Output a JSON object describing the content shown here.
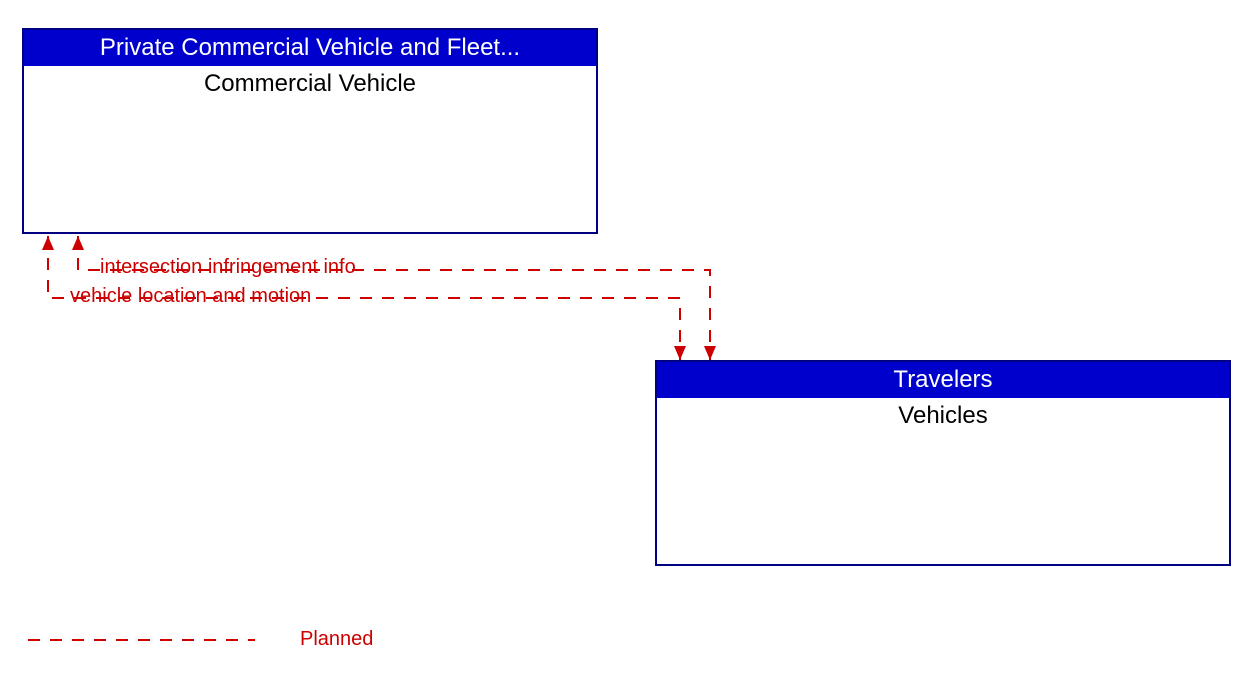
{
  "entities": {
    "commercialVehicle": {
      "header": "Private Commercial Vehicle and Fleet...",
      "body": "Commercial Vehicle"
    },
    "vehicles": {
      "header": "Travelers",
      "body": "Vehicles"
    }
  },
  "flows": {
    "intersectionInfringement": "intersection infringement info",
    "vehicleLocation": "vehicle location and motion"
  },
  "legend": {
    "planned": "Planned"
  }
}
